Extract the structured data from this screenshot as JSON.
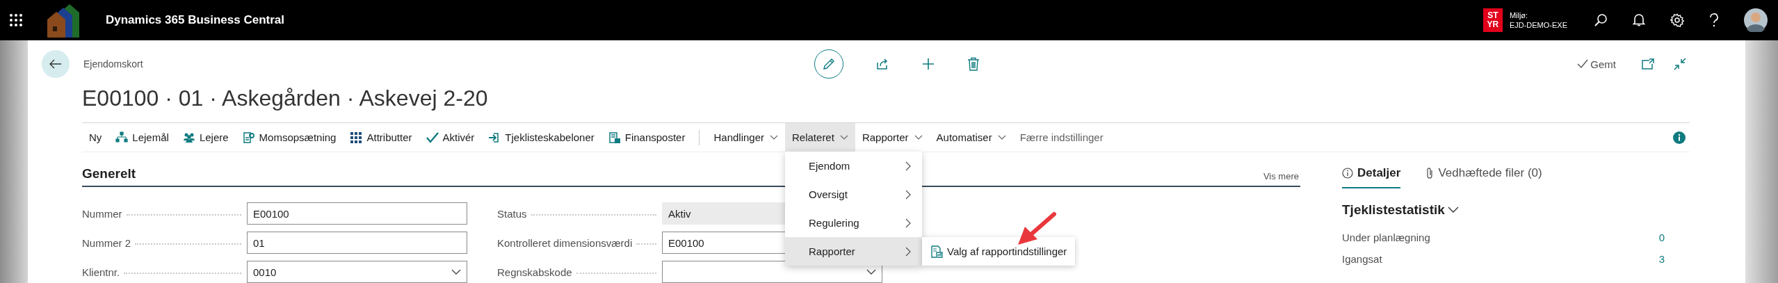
{
  "app_bar": {
    "title": "Dynamics 365 Business Central",
    "badge_lines": [
      "ST",
      "YR"
    ],
    "environment_label": "Miljø:",
    "environment_name": "EJD-DEMO-EXE"
  },
  "page": {
    "breadcrumb": "Ejendomskort",
    "title": "E00100 · 01 · Askegården · Askevej 2-20",
    "save_status": "Gemt"
  },
  "action_bar": {
    "items": [
      {
        "label": "Ny",
        "kind": "command"
      },
      {
        "label": "Lejemål",
        "kind": "command"
      },
      {
        "label": "Lejere",
        "kind": "command"
      },
      {
        "label": "Momsopsætning",
        "kind": "command"
      },
      {
        "label": "Attributter",
        "kind": "command"
      },
      {
        "label": "Aktivér",
        "kind": "command"
      },
      {
        "label": "Tjeklisteskabeloner",
        "kind": "command"
      },
      {
        "label": "Finansposter",
        "kind": "command"
      },
      {
        "label": "Handlinger",
        "kind": "menu",
        "expanded": false
      },
      {
        "label": "Relateret",
        "kind": "menu",
        "expanded": true
      },
      {
        "label": "Rapporter",
        "kind": "menu",
        "expanded": false
      },
      {
        "label": "Automatiser",
        "kind": "menu",
        "expanded": false
      },
      {
        "label": "Færre indstillinger",
        "kind": "link"
      }
    ]
  },
  "menu": {
    "items": [
      {
        "label": "Ejendom",
        "selected": false
      },
      {
        "label": "Oversigt",
        "selected": false
      },
      {
        "label": "Regulering",
        "selected": false
      },
      {
        "label": "Rapporter",
        "selected": true
      }
    ]
  },
  "submenu": {
    "items": [
      {
        "label": "Valg af rapportindstillinger"
      }
    ]
  },
  "section": {
    "title": "Generelt",
    "show_more": "Vis mere",
    "columns": [
      [
        {
          "label": "Nummer",
          "value": "E00100",
          "kind": "text"
        },
        {
          "label": "Nummer 2",
          "value": "01",
          "kind": "text"
        },
        {
          "label": "Klientnr.",
          "value": "0010",
          "kind": "dropdown"
        }
      ],
      [
        {
          "label": "Status",
          "value": "Aktiv",
          "kind": "readonly"
        },
        {
          "label": "Kontrolleret dimensionsværdi",
          "value": "E00100",
          "kind": "text"
        },
        {
          "label": "Regnskabskode",
          "kind": "dropdown"
        }
      ]
    ]
  },
  "factbox": {
    "tabs": [
      {
        "label": "Detaljer",
        "selected": true
      },
      {
        "label": "Vedhæftede filer (0)",
        "selected": false
      }
    ],
    "heading": "Tjeklistestatistik",
    "rows": [
      {
        "label": "Under planlægning",
        "value": "0"
      },
      {
        "label": "Igangsat",
        "value": "3"
      }
    ]
  }
}
